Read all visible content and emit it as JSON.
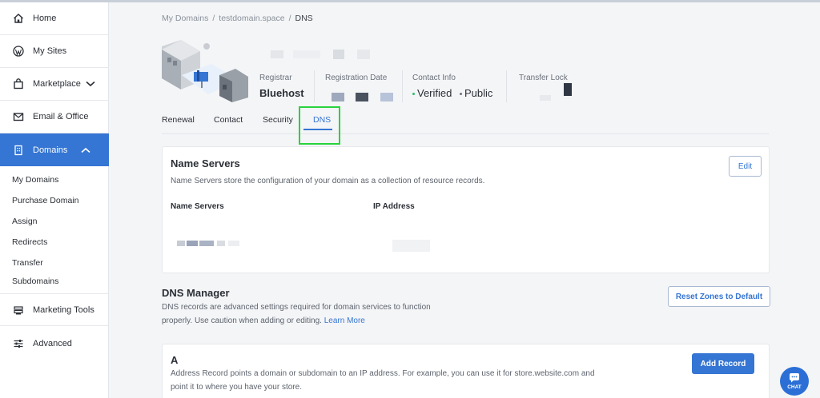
{
  "sidebar": {
    "items": [
      {
        "label": "Home",
        "icon": "home-icon"
      },
      {
        "label": "My Sites",
        "icon": "wordpress-icon"
      },
      {
        "label": "Marketplace",
        "icon": "shopping-bag-icon"
      },
      {
        "label": "Email & Office",
        "icon": "email-icon"
      },
      {
        "label": "Domains",
        "icon": "building-icon"
      },
      {
        "label": "Marketing Tools",
        "icon": "marketing-icon"
      },
      {
        "label": "Advanced",
        "icon": "sliders-icon"
      }
    ],
    "domains_sub": [
      "My Domains",
      "Purchase Domain",
      "Assign",
      "Redirects",
      "Transfer",
      "Subdomains"
    ]
  },
  "breadcrumb": {
    "root": "My Domains",
    "domain": "testdomain.space",
    "current": "DNS",
    "sep": "/"
  },
  "summary": {
    "registrar_label": "Registrar",
    "registrar_value": "Bluehost",
    "registration_label": "Registration Date",
    "contact_label": "Contact Info",
    "contact_verified": "Verified",
    "contact_public": "Public",
    "transfer_label": "Transfer Lock",
    "colors": {
      "verified": "#2bbf6a",
      "public": "#6a707a"
    }
  },
  "tabs": [
    "Renewal",
    "Contact",
    "Security",
    "DNS"
  ],
  "name_servers": {
    "title": "Name Servers",
    "description": "Name Servers store the configuration of your domain as a collection of resource records.",
    "edit_label": "Edit",
    "col_name_servers": "Name Servers",
    "col_ip": "IP Address"
  },
  "dns_manager": {
    "title": "DNS Manager",
    "desc_line1": "DNS records are advanced settings required for domain services to function",
    "desc_line2": "properly. Use caution when adding or editing.",
    "learn_more": "Learn More",
    "reset_label": "Reset Zones to Default"
  },
  "a_record": {
    "title": "A",
    "desc_line1": "Address Record points a domain or subdomain to an IP address. For example, you can use it for store.website.com and",
    "desc_line2": "point it to where you have your store.",
    "add_label": "Add Record"
  },
  "chat": {
    "label": "CHAT"
  },
  "colors": {
    "accent": "#3575d3",
    "highlight": "#28d33c"
  }
}
